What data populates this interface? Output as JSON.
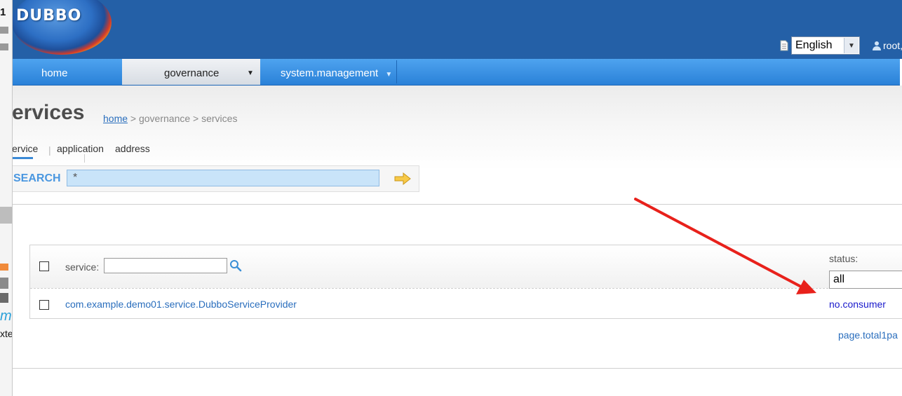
{
  "left_strip": {
    "top_char": "1",
    "char_m": "m",
    "char_xt": "xte"
  },
  "header": {
    "logo_text": "DUBBO",
    "language": {
      "selected": "English",
      "icon": "document-icon"
    },
    "user": {
      "text": "root, w",
      "icon": "user-icon"
    }
  },
  "nav": {
    "items": [
      {
        "label": "home"
      },
      {
        "label": "governance",
        "arrow": "▼"
      },
      {
        "label": "system.management",
        "arrow": "▼"
      }
    ]
  },
  "page": {
    "title": "ervices",
    "breadcrumb": {
      "home": "home",
      "rest": " > governance > services"
    }
  },
  "tabs": {
    "service": "ervice",
    "sep": "|",
    "application": "application",
    "address": "address"
  },
  "search": {
    "label": "SEARCH",
    "value": "*",
    "go_icon": "arrow-right-icon"
  },
  "table": {
    "service_label": "service:",
    "service_filter_value": "",
    "status_label": "status:",
    "status_selected": "all",
    "rows": [
      {
        "service": "com.example.demo01.service.DubboServiceProvider",
        "status": "no.consumer"
      }
    ]
  },
  "pager": {
    "text": "page.total1pa"
  },
  "annotation": {
    "color": "#e8211b"
  }
}
